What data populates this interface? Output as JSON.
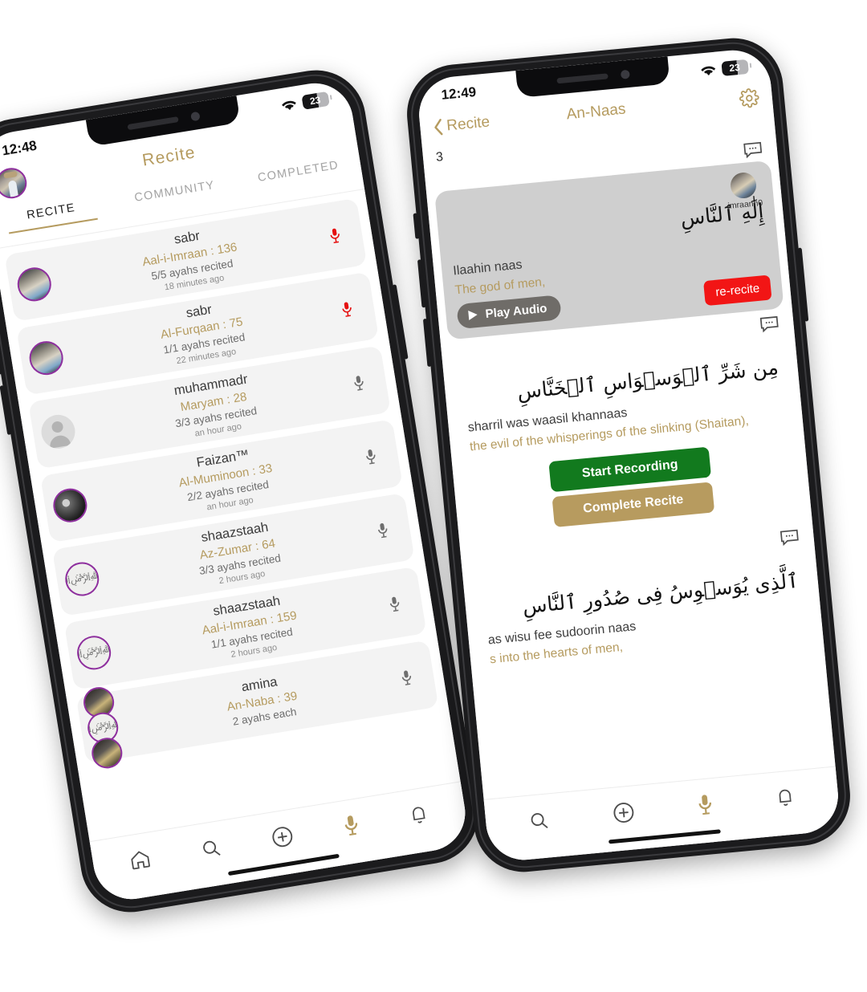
{
  "left_phone": {
    "status": {
      "time": "12:48",
      "wifi_icon": "wifi-icon",
      "battery": "23"
    },
    "header": {
      "title": "Recite",
      "avatar_icon": "user-avatar"
    },
    "tabs": [
      {
        "label": "RECITE",
        "active": true
      },
      {
        "label": "COMMUNITY",
        "active": false
      },
      {
        "label": "COMPLETED",
        "active": false
      }
    ],
    "rows": [
      {
        "user": "sabr",
        "surah": "Aal-i-Imraan : 136",
        "ayahs": "5/5 ayahs recited",
        "time": "18 minutes ago",
        "mic": "mic-icon-red"
      },
      {
        "user": "sabr",
        "surah": "Al-Furqaan : 75",
        "ayahs": "1/1 ayahs recited",
        "time": "22 minutes ago",
        "mic": "mic-icon-red"
      },
      {
        "user": "muhammadr",
        "surah": "Maryam : 28",
        "ayahs": "3/3 ayahs recited",
        "time": "an hour ago",
        "mic": "mic-icon-gray"
      },
      {
        "user": "Faizan™",
        "surah": "Al-Muminoon : 33",
        "ayahs": "2/2 ayahs recited",
        "time": "an hour ago",
        "mic": "mic-icon-gray"
      },
      {
        "user": "shaazstaah",
        "surah": "Az-Zumar : 64",
        "ayahs": "3/3 ayahs recited",
        "time": "2 hours ago",
        "mic": "mic-icon-gray"
      },
      {
        "user": "shaazstaah",
        "surah": "Aal-i-Imraan : 159",
        "ayahs": "1/1 ayahs recited",
        "time": "2 hours ago",
        "mic": "mic-icon-gray"
      },
      {
        "user": "amina",
        "surah": "An-Naba : 39",
        "ayahs": "2 ayahs each",
        "time": "",
        "mic": "mic-icon-gray"
      }
    ],
    "bottom_nav": [
      "home-icon",
      "search-icon",
      "plus-circle-icon",
      "mic-icon",
      "bell-icon"
    ],
    "bottom_nav_active": "mic-icon"
  },
  "right_phone": {
    "status": {
      "time": "12:49",
      "wifi_icon": "wifi-icon",
      "battery": "23"
    },
    "header": {
      "back_label": "Recite",
      "title": "An-Naas",
      "gear_icon": "gear-icon"
    },
    "ayah_number": "3",
    "verses": [
      {
        "username": "imraann0",
        "arabic": "إِلَٰهِ ٱلنَّاسِ",
        "transliteration": "Ilaahin naas",
        "translation": "The god of men,",
        "play_label": "Play Audio",
        "rerecite_label": "re-recite",
        "state": "active"
      },
      {
        "arabic": "مِن شَرِّ ٱلۡوَسۡوَاسِ ٱلۡخَنَّاسِ",
        "transliteration": "sharril was waasil khannaas",
        "translation": "the evil of the whisperings of the slinking (Shaitan),",
        "start_recording_label": "Start Recording",
        "complete_recite_label": "Complete Recite",
        "state": "plain"
      },
      {
        "arabic": "ٱلَّذِى يُوَسۡوِسُ فِى صُدُورِ ٱلنَّاسِ",
        "transliteration": "as wisu fee sudoorin naas",
        "translation": "s into the hearts of men,",
        "state": "plain"
      }
    ],
    "bottom_nav": [
      "search-icon",
      "plus-circle-icon",
      "mic-icon",
      "bell-icon"
    ],
    "bottom_nav_active": "mic-icon"
  },
  "colors": {
    "gold": "#b59b5f",
    "green": "#127a1e",
    "red": "#f21515",
    "mic_red": "#e51010",
    "ring_purple": "#8e2f9e",
    "card_gray": "#f3f3f3",
    "active_card": "#cfcfcf"
  }
}
